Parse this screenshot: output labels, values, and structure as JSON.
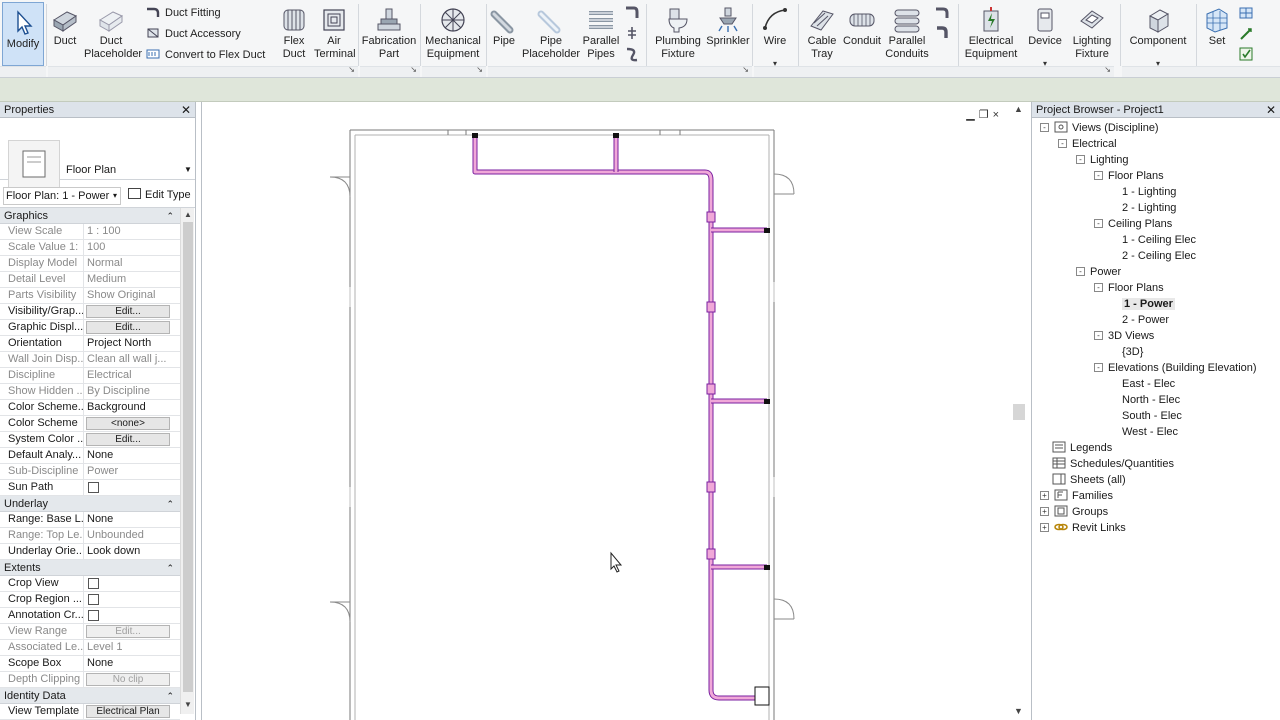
{
  "ribbon": {
    "tools": [
      {
        "label": "Modify",
        "icon": "cursor-arrow-icon"
      },
      {
        "label": "Duct",
        "icon": "duct-icon"
      },
      {
        "label": "Duct\nPlaceholder",
        "icon": "duct-placeholder-icon"
      },
      {
        "label": "Flex\nDuct",
        "icon": "flex-duct-icon"
      },
      {
        "label": "Air\nTerminal",
        "icon": "air-terminal-icon"
      },
      {
        "label": "Fabrication\nPart",
        "icon": "fabrication-part-icon"
      },
      {
        "label": "Mechanical\nEquipment",
        "icon": "mechanical-equipment-icon"
      },
      {
        "label": "Pipe",
        "icon": "pipe-icon"
      },
      {
        "label": "Pipe\nPlaceholder",
        "icon": "pipe-placeholder-icon"
      },
      {
        "label": "Parallel\nPipes",
        "icon": "parallel-pipes-icon"
      },
      {
        "label": "Plumbing\nFixture",
        "icon": "plumbing-fixture-icon"
      },
      {
        "label": "Sprinkler",
        "icon": "sprinkler-icon"
      },
      {
        "label": "Wire",
        "icon": "wire-icon"
      },
      {
        "label": "Cable\nTray",
        "icon": "cable-tray-icon"
      },
      {
        "label": "Conduit",
        "icon": "conduit-icon"
      },
      {
        "label": "Parallel\nConduits",
        "icon": "parallel-conduits-icon"
      },
      {
        "label": "Electrical\nEquipment",
        "icon": "electrical-equipment-icon"
      },
      {
        "label": "Device",
        "icon": "device-icon"
      },
      {
        "label": "Lighting\nFixture",
        "icon": "lighting-fixture-icon"
      },
      {
        "label": "Component",
        "icon": "component-icon"
      },
      {
        "label": "Set",
        "icon": "workplane-set-icon"
      }
    ],
    "small_tools": {
      "duct_fitting": "Duct Fitting",
      "duct_accessory": "Duct Accessory",
      "convert_flex": "Convert to Flex Duct"
    }
  },
  "properties": {
    "title": "Properties",
    "type_name": "Floor Plan",
    "instance": "Floor Plan: 1 - Power",
    "edit_type": "Edit Type",
    "groups": {
      "graphics": "Graphics",
      "underlay": "Underlay",
      "extents": "Extents",
      "identity": "Identity Data"
    },
    "graphics_rows": [
      {
        "name": "View Scale",
        "value": "1 : 100",
        "kind": "text",
        "dim": true
      },
      {
        "name": "Scale Value    1:",
        "value": "100",
        "kind": "text",
        "dim": true
      },
      {
        "name": "Display Model",
        "value": "Normal",
        "kind": "text",
        "dim": true
      },
      {
        "name": "Detail Level",
        "value": "Medium",
        "kind": "text",
        "dim": true
      },
      {
        "name": "Parts Visibility",
        "value": "Show Original",
        "kind": "text",
        "dim": true
      },
      {
        "name": "Visibility/Grap...",
        "value": "Edit...",
        "kind": "button",
        "dim": false
      },
      {
        "name": "Graphic Displ...",
        "value": "Edit...",
        "kind": "button",
        "dim": false
      },
      {
        "name": "Orientation",
        "value": "Project North",
        "kind": "text",
        "dim": false
      },
      {
        "name": "Wall Join Disp...",
        "value": "Clean all wall j...",
        "kind": "text",
        "dim": true
      },
      {
        "name": "Discipline",
        "value": "Electrical",
        "kind": "text",
        "dim": true
      },
      {
        "name": "Show Hidden ...",
        "value": "By Discipline",
        "kind": "text",
        "dim": true
      },
      {
        "name": "Color Scheme...",
        "value": "Background",
        "kind": "text",
        "dim": false
      },
      {
        "name": "Color Scheme",
        "value": "<none>",
        "kind": "button",
        "dim": false
      },
      {
        "name": "System Color ...",
        "value": "Edit...",
        "kind": "button",
        "dim": false
      },
      {
        "name": "Default Analy...",
        "value": "None",
        "kind": "text",
        "dim": false
      },
      {
        "name": "Sub-Discipline",
        "value": "Power",
        "kind": "text",
        "dim": true
      },
      {
        "name": "Sun Path",
        "value": "",
        "kind": "check",
        "dim": false
      }
    ],
    "underlay_rows": [
      {
        "name": "Range: Base L...",
        "value": "None",
        "kind": "text",
        "dim": false
      },
      {
        "name": "Range: Top Le...",
        "value": "Unbounded",
        "kind": "text",
        "dim": true
      },
      {
        "name": "Underlay Orie...",
        "value": "Look down",
        "kind": "text",
        "dim": false
      }
    ],
    "extents_rows": [
      {
        "name": "Crop View",
        "value": "",
        "kind": "check",
        "dim": false
      },
      {
        "name": "Crop Region ...",
        "value": "",
        "kind": "check",
        "dim": false
      },
      {
        "name": "Annotation Cr...",
        "value": "",
        "kind": "check",
        "dim": false
      },
      {
        "name": "View Range",
        "value": "Edit...",
        "kind": "button",
        "dim": true
      },
      {
        "name": "Associated Le...",
        "value": "Level 1",
        "kind": "text",
        "dim": true
      },
      {
        "name": "Scope Box",
        "value": "None",
        "kind": "text",
        "dim": false
      },
      {
        "name": "Depth Clipping",
        "value": "No clip",
        "kind": "button",
        "dim": true
      }
    ],
    "identity_rows": [
      {
        "name": "View Template",
        "value": "Electrical Plan",
        "kind": "button",
        "dim": false
      }
    ]
  },
  "browser": {
    "title": "Project Browser - Project1",
    "tree": [
      {
        "label": "Views (Discipline)",
        "level": 0,
        "toggle": "-",
        "icon": "views-icon"
      },
      {
        "label": "Electrical",
        "level": 1,
        "toggle": "-"
      },
      {
        "label": "Lighting",
        "level": 2,
        "toggle": "-"
      },
      {
        "label": "Floor Plans",
        "level": 3,
        "toggle": "-"
      },
      {
        "label": "1 - Lighting",
        "level": 4
      },
      {
        "label": "2 - Lighting",
        "level": 4
      },
      {
        "label": "Ceiling Plans",
        "level": 3,
        "toggle": "-"
      },
      {
        "label": "1 - Ceiling Elec",
        "level": 4
      },
      {
        "label": "2 - Ceiling Elec",
        "level": 4
      },
      {
        "label": "Power",
        "level": 2,
        "toggle": "-"
      },
      {
        "label": "Floor Plans",
        "level": 3,
        "toggle": "-"
      },
      {
        "label": "1 - Power",
        "level": 4,
        "selected": true
      },
      {
        "label": "2 - Power",
        "level": 4
      },
      {
        "label": "3D Views",
        "level": 3,
        "toggle": "-"
      },
      {
        "label": "{3D}",
        "level": 4
      },
      {
        "label": "Elevations (Building Elevation)",
        "level": 3,
        "toggle": "-"
      },
      {
        "label": "East - Elec",
        "level": 4
      },
      {
        "label": "North - Elec",
        "level": 4
      },
      {
        "label": "South - Elec",
        "level": 4
      },
      {
        "label": "West - Elec",
        "level": 4
      },
      {
        "label": "Legends",
        "level": 0,
        "icon": "legends-icon"
      },
      {
        "label": "Schedules/Quantities",
        "level": 0,
        "icon": "schedules-icon"
      },
      {
        "label": "Sheets (all)",
        "level": 0,
        "icon": "sheets-icon"
      },
      {
        "label": "Families",
        "level": 0,
        "toggle": "+",
        "icon": "families-icon"
      },
      {
        "label": "Groups",
        "level": 0,
        "toggle": "+",
        "icon": "groups-icon"
      },
      {
        "label": "Revit Links",
        "level": 0,
        "toggle": "+",
        "icon": "revit-links-icon"
      }
    ]
  },
  "view": {
    "close_glyph": "×",
    "conduit_color": "#7a1fa0",
    "conduit_fill": "#f0a8d8"
  }
}
